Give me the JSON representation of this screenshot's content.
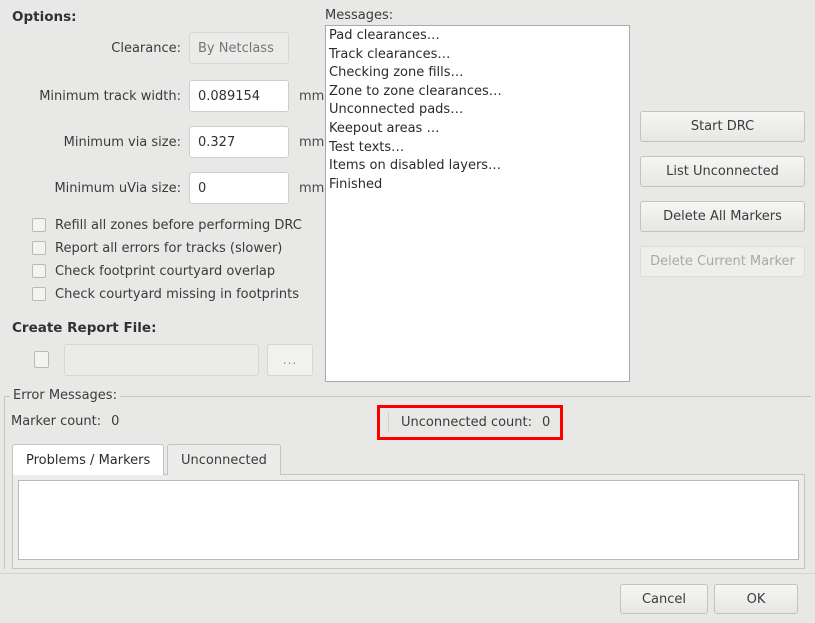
{
  "options": {
    "heading": "Options:",
    "fields": [
      {
        "label": "Clearance:",
        "value": "",
        "placeholder": "By Netclass",
        "unit": "",
        "disabled": true
      },
      {
        "label": "Minimum track width:",
        "value": "0.089154",
        "placeholder": "",
        "unit": "mm",
        "disabled": false
      },
      {
        "label": "Minimum via size:",
        "value": "0.327",
        "placeholder": "",
        "unit": "mm",
        "disabled": false
      },
      {
        "label": "Minimum uVia size:",
        "value": "0",
        "placeholder": "",
        "unit": "mm",
        "disabled": false
      }
    ],
    "checkboxes": [
      {
        "label": "Refill all zones before performing DRC",
        "checked": false
      },
      {
        "label": "Report all errors for tracks (slower)",
        "checked": false
      },
      {
        "label": "Check footprint courtyard overlap",
        "checked": false
      },
      {
        "label": "Check courtyard missing in footprints",
        "checked": false
      }
    ]
  },
  "report_file": {
    "heading": "Create Report File:",
    "checked": false,
    "path_value": "",
    "path_placeholder": "",
    "browse_label": "..."
  },
  "messages": {
    "label": "Messages:",
    "lines": [
      "Pad clearances…",
      "Track clearances…",
      "Checking zone fills…",
      "Zone to zone clearances…",
      "Unconnected pads…",
      "Keepout areas …",
      "Test texts…",
      "Items on disabled layers…",
      "Finished"
    ]
  },
  "actions": [
    {
      "label": "Start DRC",
      "disabled": false
    },
    {
      "label": "List Unconnected",
      "disabled": false
    },
    {
      "label": "Delete All Markers",
      "disabled": false
    },
    {
      "label": "Delete Current Marker",
      "disabled": true
    }
  ],
  "error_messages": {
    "group_label": "Error Messages:",
    "marker_count_label": "Marker count:",
    "marker_count_value": "0",
    "unconnected_count_label": "Unconnected count:",
    "unconnected_count_value": "0",
    "highlight_color": "#fc0000",
    "tabs": [
      {
        "label": "Problems / Markers",
        "active": true
      },
      {
        "label": "Unconnected",
        "active": false
      }
    ],
    "list_rows": []
  },
  "dialog_buttons": {
    "cancel_label": "Cancel",
    "ok_label": "OK"
  }
}
